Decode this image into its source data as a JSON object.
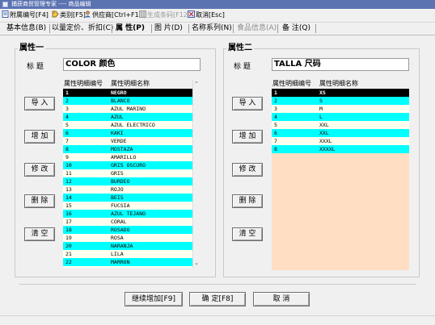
{
  "window": {
    "title": "捕获商贸管理专家 ---- 商品编辑"
  },
  "toolbar": [
    {
      "name": "attach-number-tool",
      "icon": "notebook-icon",
      "label": "附属编号[F4]",
      "disabled": false
    },
    {
      "name": "category-tool",
      "icon": "tag-icon",
      "label": "类别[F5]",
      "disabled": false
    },
    {
      "name": "supplier-tool",
      "icon": "person-icon",
      "label": "供应商[Ctrl+F10]",
      "disabled": false
    },
    {
      "name": "generate-barcode-tool",
      "icon": "grid-icon",
      "label": "生成条码[F12]",
      "disabled": true
    },
    {
      "name": "cancel-tool",
      "icon": "cancel-icon",
      "label": "取消[Esc]",
      "disabled": false
    }
  ],
  "tabs": [
    {
      "name": "tab-basic-info",
      "label": "基本信息(B)",
      "active": false,
      "disabled": false
    },
    {
      "name": "tab-bulk-pricing",
      "label": "以量定价、折扣(C)",
      "active": false,
      "disabled": false
    },
    {
      "name": "tab-attributes",
      "label": "属 性(P)",
      "active": true,
      "disabled": false
    },
    {
      "name": "tab-images",
      "label": "图 片(D)",
      "active": false,
      "disabled": false
    },
    {
      "name": "tab-name-series",
      "label": "名称系列(N)",
      "active": false,
      "disabled": false
    },
    {
      "name": "tab-food-info",
      "label": "食品信息(A)",
      "active": false,
      "disabled": true
    },
    {
      "name": "tab-remarks",
      "label": "备 注(Q)",
      "active": false,
      "disabled": false
    }
  ],
  "attr1": {
    "group_title": "属性一",
    "title_label": "标 题",
    "title_value": "COLOR 颜色",
    "col_number": "属性明细编号",
    "col_name": "属性明细名称",
    "buttons": [
      "导 入",
      "增 加",
      "修 改",
      "删 除",
      "清 空"
    ],
    "rows": [
      [
        "1",
        "NEGRO"
      ],
      [
        "2",
        "BLANCO"
      ],
      [
        "3",
        "AZUL MARINO"
      ],
      [
        "4",
        "AZUL"
      ],
      [
        "5",
        "AZUL ELECTRICO"
      ],
      [
        "6",
        "KAKI"
      ],
      [
        "7",
        "VERDE"
      ],
      [
        "8",
        "MOSTAZA"
      ],
      [
        "9",
        "AMARILLO"
      ],
      [
        "10",
        "GRIS OSCURO"
      ],
      [
        "11",
        "GRIS"
      ],
      [
        "12",
        "BURDEO"
      ],
      [
        "13",
        "ROJO"
      ],
      [
        "14",
        "BEIS"
      ],
      [
        "15",
        "FUCSIA"
      ],
      [
        "16",
        "AZUL TEJANO"
      ],
      [
        "17",
        "CORAL"
      ],
      [
        "18",
        "ROSADO"
      ],
      [
        "19",
        "ROSA"
      ],
      [
        "20",
        "NARANJA"
      ],
      [
        "21",
        "LILA"
      ],
      [
        "22",
        "MARRON"
      ]
    ]
  },
  "attr2": {
    "group_title": "属性二",
    "title_label": "标 题",
    "title_value": "TALLA 尺码",
    "col_number": "属性明细编号",
    "col_name": "属性明细名称",
    "buttons": [
      "导 入",
      "增 加",
      "修 改",
      "删 除",
      "清 空"
    ],
    "rows": [
      [
        "1",
        "XS"
      ],
      [
        "2",
        "S"
      ],
      [
        "3",
        "M"
      ],
      [
        "4",
        "L"
      ],
      [
        "5",
        "XXL"
      ],
      [
        "6",
        "XXL"
      ],
      [
        "7",
        "XXXL"
      ],
      [
        "8",
        "XXXXL"
      ]
    ]
  },
  "footer": {
    "continue_label": "继续增加[F9]",
    "confirm_label": "确 定[F8]",
    "cancel_label": "取 消"
  },
  "colors": {
    "selected_row_bg": "#000000",
    "alt_row_bg": "#00ffff",
    "row_bg": "#fffff0",
    "empty_grid_bg": "#ffdec4",
    "title_bar": "#5b73b1"
  }
}
